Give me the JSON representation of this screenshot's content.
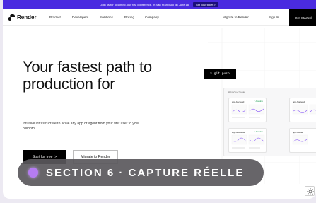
{
  "banner": {
    "text": "Join us for localhost, our first conference, in San Francisco on June 18",
    "cta": "Get your ticket  >"
  },
  "nav": {
    "brand": "Render",
    "links": [
      "Product",
      "Developers",
      "Solutions",
      "Pricing",
      "Company"
    ],
    "migrate": "Migrate to Render",
    "signin": "Sign In",
    "get_started": "Get Started"
  },
  "hero": {
    "title": "Your fastest path to production for",
    "subtitle": "Intuitive infrastructure to scale any app or agent from your first user to your billionth.",
    "primary_cta": "Start for free",
    "primary_arrow": ">",
    "secondary_cta": "Migrate to Render"
  },
  "visual": {
    "terminal": "$ git push",
    "panel_label": "PRODUCTION",
    "cards": [
      {
        "title": "app-backend",
        "status": "✓ Available"
      },
      {
        "title": "app-frontend",
        "status": ""
      },
      {
        "title": "app-database",
        "status": "✓ Available"
      },
      {
        "title": "app-queue",
        "status": ""
      }
    ]
  },
  "overlay": {
    "label": "SECTION 6 · CAPTURE RÉELLE"
  },
  "icons": {
    "theme_toggle": "sun-icon",
    "logo": "render-logo-icon"
  },
  "colors": {
    "banner": "#4a2be0",
    "accent": "#000000",
    "overlay_dot": "#b57cf2",
    "chart_line": "#8b5cf6"
  }
}
